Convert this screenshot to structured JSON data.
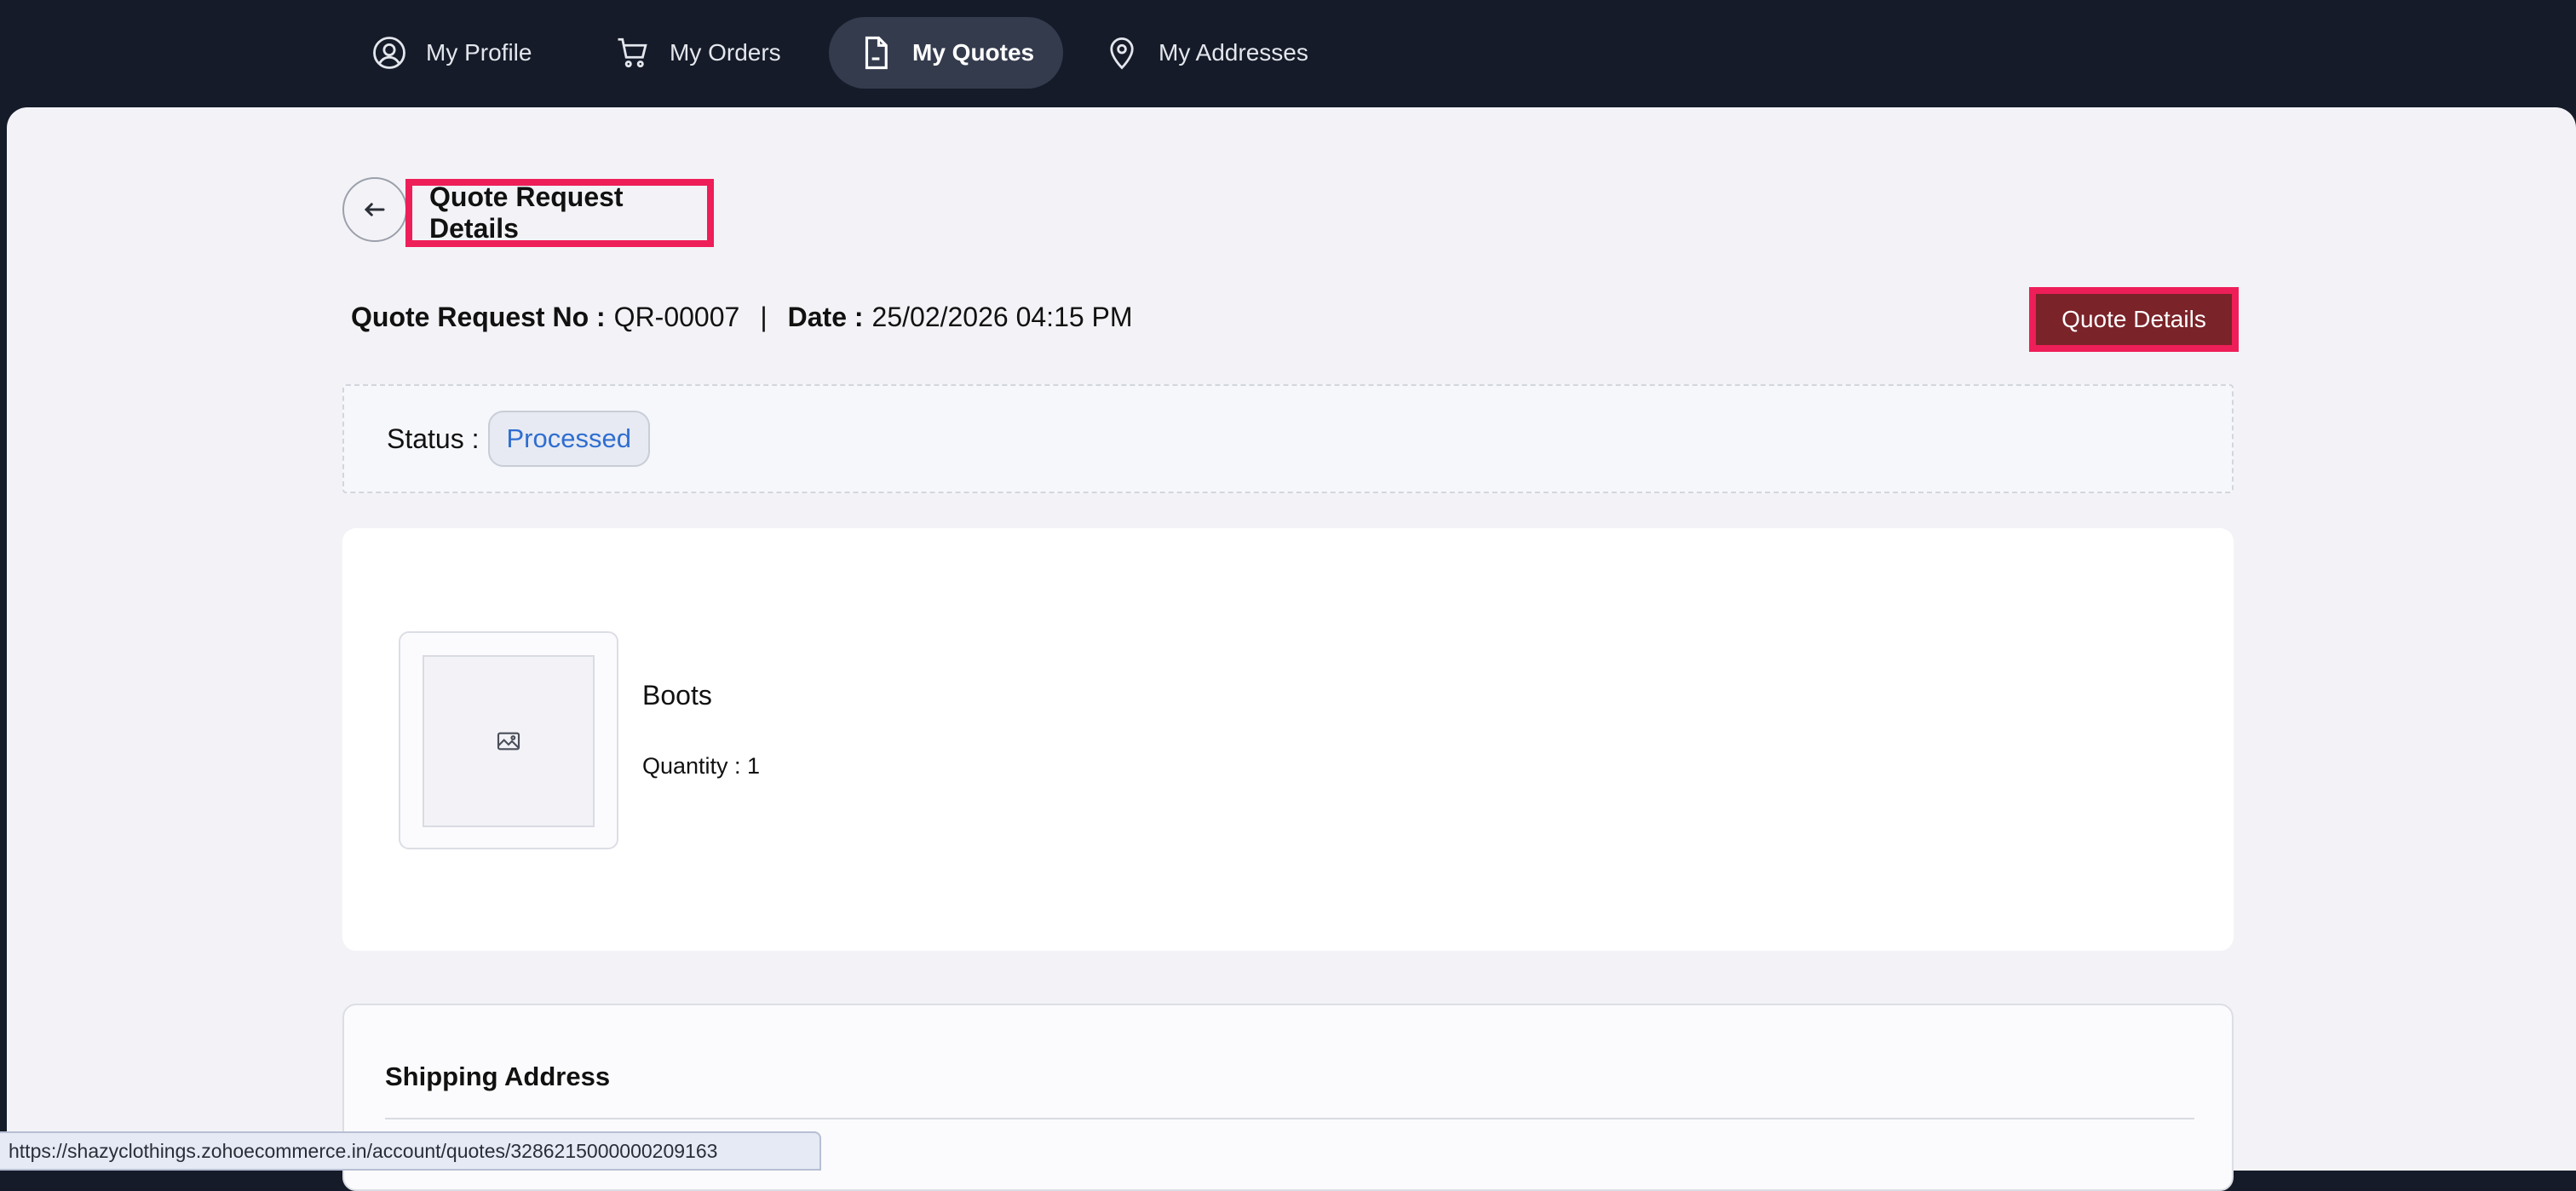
{
  "nav": {
    "items": [
      {
        "label": "My Profile",
        "icon": "user-circle-icon"
      },
      {
        "label": "My Orders",
        "icon": "cart-icon"
      },
      {
        "label": "My Quotes",
        "icon": "document-icon",
        "active": true
      },
      {
        "label": "My Addresses",
        "icon": "location-pin-icon"
      }
    ]
  },
  "page": {
    "title": "Quote Request Details",
    "back_icon": "back-arrow-icon"
  },
  "quote": {
    "number_label": "Quote Request No :",
    "number": "QR-00007",
    "separator": "|",
    "date_label": "Date :",
    "date": "25/02/2026 04:15 PM",
    "details_button": "Quote Details"
  },
  "status": {
    "label": "Status :",
    "value": "Processed"
  },
  "item": {
    "name": "Boots",
    "quantity": "Quantity : 1",
    "image_icon": "image-placeholder-icon"
  },
  "shipping": {
    "title": "Shipping Address"
  },
  "statusbar": {
    "url": "https://shazyclothings.zohoecommerce.in/account/quotes/3286215000000209163"
  },
  "colors": {
    "nav_bg": "#151b29",
    "accent_highlight": "#ee1e59",
    "button_bg": "#7a2329",
    "status_text": "#2f6ed0"
  }
}
